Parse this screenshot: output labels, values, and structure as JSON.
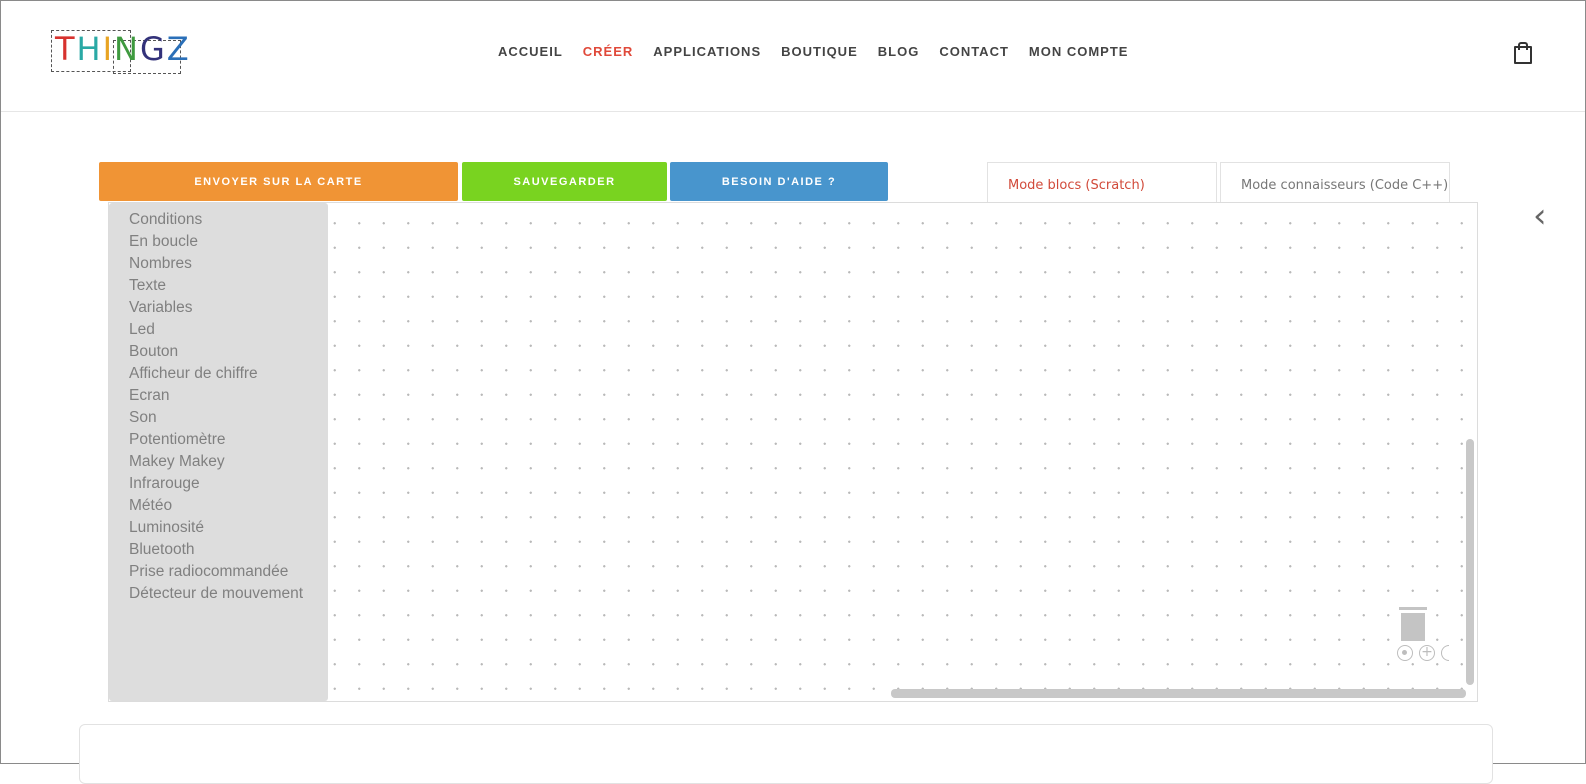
{
  "header": {
    "logo_text": "THINGZ",
    "logo_colors": [
      "#d7322e",
      "#2aa9a5",
      "#e8a423",
      "#3e9a3f",
      "#33327a",
      "#2a6fb8"
    ],
    "nav": [
      {
        "label": "ACCUEIL",
        "active": false
      },
      {
        "label": "CRÉER",
        "active": true
      },
      {
        "label": "APPLICATIONS",
        "active": false
      },
      {
        "label": "BOUTIQUE",
        "active": false
      },
      {
        "label": "BLOG",
        "active": false
      },
      {
        "label": "CONTACT",
        "active": false
      },
      {
        "label": "MON COMPTE",
        "active": false
      }
    ],
    "cart_icon": "shopping-bag-icon"
  },
  "toolbar": {
    "send_label": "ENVOYER SUR LA CARTE",
    "save_label": "SAUVEGARDER",
    "help_label": "BESOIN D'AIDE ?",
    "colors": {
      "send": "#f09435",
      "save": "#79d320",
      "help": "#4895cd"
    }
  },
  "modes": {
    "blocks_label": "Mode blocs (Scratch)",
    "code_label": "Mode connaisseurs (Code C++)",
    "active": "blocks"
  },
  "toolbox": {
    "categories": [
      "Conditions",
      "En boucle",
      "Nombres",
      "Texte",
      "Variables",
      "Led",
      "Bouton",
      "Afficheur de chiffre",
      "Ecran",
      "Son",
      "Potentiomètre",
      "Makey Makey",
      "Infrarouge",
      "Météo",
      "Luminosité",
      "Bluetooth",
      "Prise radiocommandée",
      "Détecteur de mouvement"
    ]
  },
  "workspace": {
    "trash_icon": "trash-icon",
    "zoom_controls": [
      "zoom-reset-icon",
      "zoom-in-icon",
      "zoom-out-icon"
    ]
  },
  "side_arrow_icon": "chevron-left-icon"
}
